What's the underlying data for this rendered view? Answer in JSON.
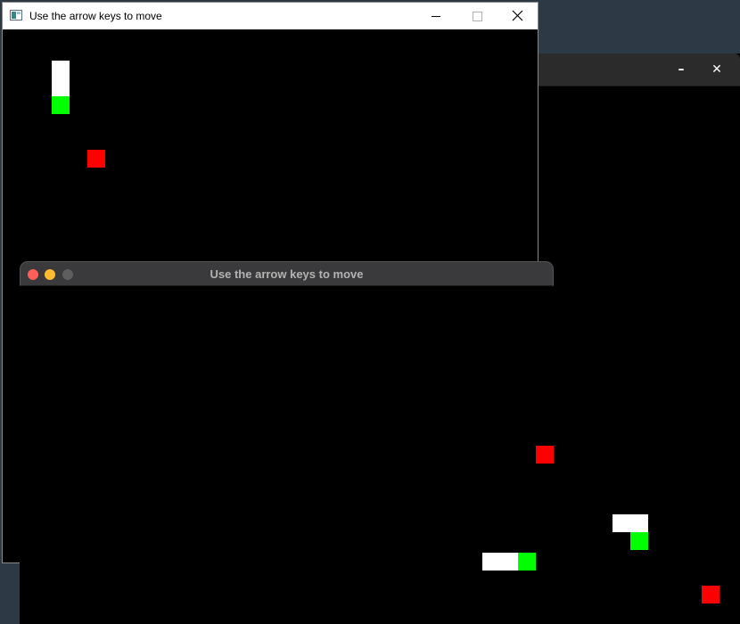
{
  "windows": {
    "windows_style": {
      "title": "Use the arrow keys to move",
      "snake": {
        "head_color": "#00ff00",
        "body_color": "#ffffff"
      },
      "food": {
        "color": "#ff0000"
      }
    },
    "mac_style": {
      "title": "Use the arrow keys to move",
      "traffic_lights": [
        "#ff5f57",
        "#febc2e",
        "#5e5e5e"
      ],
      "snake": {
        "head_color": "#00ff00",
        "body_color": "#ffffff"
      },
      "food": {
        "color": "#ff0000"
      }
    },
    "linux_style": {
      "title": "",
      "minimize_glyph": "–",
      "close_glyph": "✕",
      "snake": {
        "head_color": "#00ff00",
        "body_color": "#ffffff"
      },
      "food": {
        "color": "#ff0000"
      }
    }
  }
}
